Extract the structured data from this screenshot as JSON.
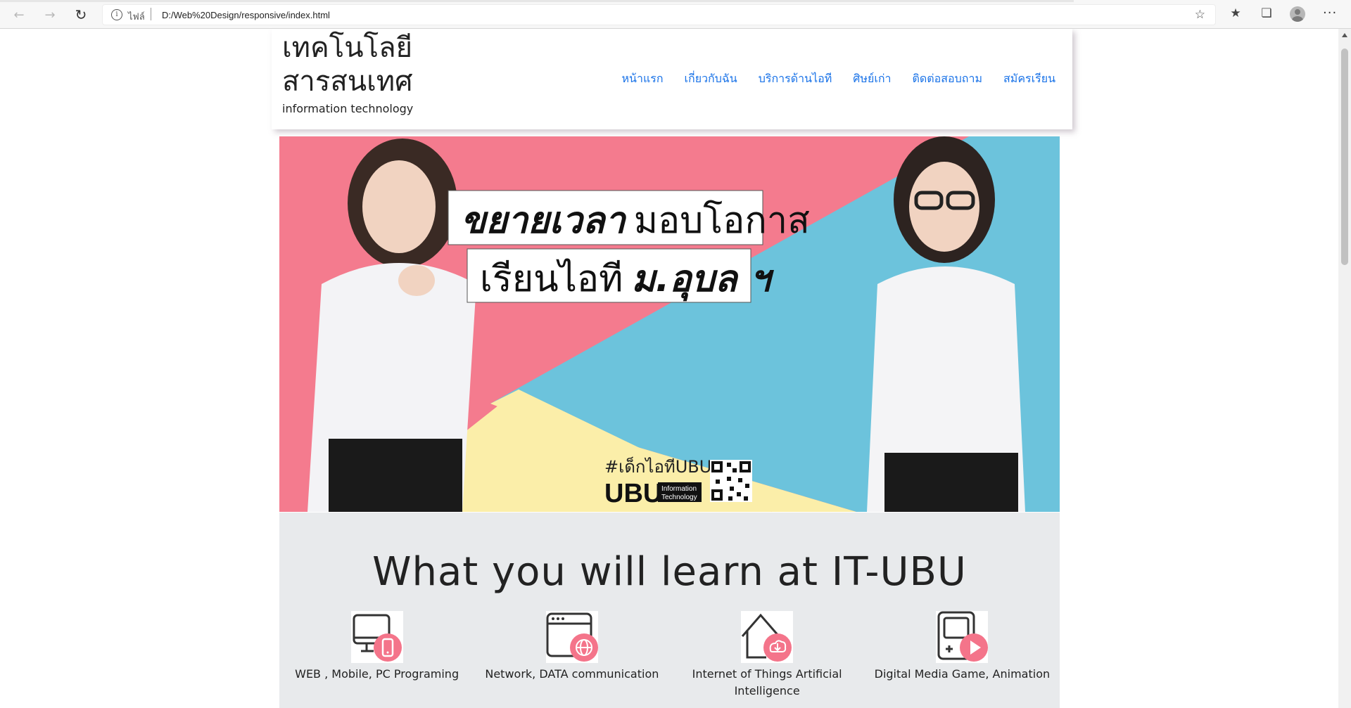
{
  "browser": {
    "scheme_label": "ไฟล์",
    "url": "D:/Web%20Design/responsive/index.html",
    "icons": [
      "back-icon",
      "forward-icon",
      "refresh-icon",
      "info-icon",
      "add-favorite-icon",
      "favorites-icon",
      "collections-icon",
      "profile-avatar",
      "more-icon"
    ]
  },
  "header": {
    "title_line1": "เทคโนโลยี",
    "title_line2": "สารสนเทศ",
    "subtitle": "information technology",
    "menu": [
      {
        "label": "หน้าแรก"
      },
      {
        "label": "เกี่ยวกับฉัน"
      },
      {
        "label": "บริการด้านไอที"
      },
      {
        "label": "ศิษย์เก่า"
      },
      {
        "label": "ติดต่อสอบถาม"
      },
      {
        "label": "สมัครเรียน"
      }
    ]
  },
  "banner": {
    "headline_line1_bold": "ขยายเวลา",
    "headline_line1_rest": "มอบโอกาส",
    "headline_line2_rest": "เรียนไอที",
    "headline_line2_bold": "ม.อุบล ฯ",
    "hashtag": "#เด็กไอทีUBU",
    "logo_text": "UBU",
    "logo_sub1": "Information",
    "logo_sub2": "Technology",
    "colors": {
      "pink": "#f47b8e",
      "blue": "#6cc3dc",
      "yellow": "#fbeea9"
    }
  },
  "learn": {
    "title": "What you will learn at IT-UBU",
    "items": [
      {
        "caption": "WEB , Mobile, PC Programing",
        "icon": "monitor-mobile-icon"
      },
      {
        "caption": "Network, DATA communication",
        "icon": "browser-globe-icon"
      },
      {
        "caption": "Internet of Things Artificial Intelligence",
        "icon": "home-cloud-icon"
      },
      {
        "caption": "Digital Media Game, Animation",
        "icon": "game-play-icon"
      }
    ],
    "accent_color": "#f4748a"
  }
}
